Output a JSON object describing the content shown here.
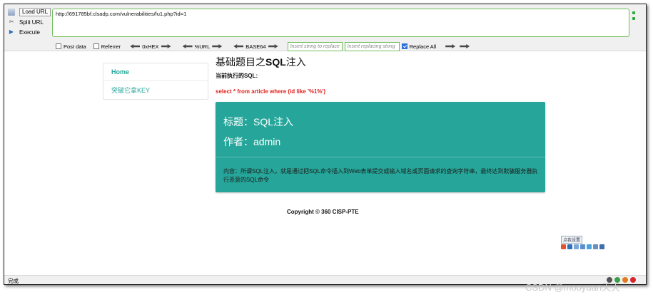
{
  "hackbar": {
    "actions": [
      {
        "label": "Load URL",
        "icon": "load-url-icon"
      },
      {
        "label": "Split URL",
        "icon": "split-url-icon"
      },
      {
        "label": "Execute",
        "icon": "execute-icon"
      }
    ],
    "url": "http://691785bf.clsadp.com/vulnerabilities/fu1.php?id=1",
    "options": {
      "post_data": "Post data",
      "referrer": "Referrer",
      "hex": "0xHEX",
      "url_enc": "%URL",
      "base64": "BASE64",
      "insert_string_placeholder": "Insert string to replace",
      "insert_replacing_placeholder": "Insert replacing string",
      "replace_all": "Replace All"
    }
  },
  "sidebar": {
    "items": [
      {
        "label": "Home",
        "active": true
      },
      {
        "label": "突破它拿KEY",
        "active": false
      }
    ]
  },
  "main": {
    "title_prefix": "基础题目之",
    "title_bold": "SQL",
    "title_suffix": "注入",
    "sql_label": "当前执行的SQL:",
    "sql_query": "select * from article where (id like '%1%')",
    "card": {
      "title_line": "标题：SQL注入",
      "author_line": "作者：admin",
      "content": "内容：所谓SQL注入，就是通过把SQL命令插入到Web表单提交或输入域名或页面请求的查询字符串，最终达到欺骗服务器执行恶意的SQL命令",
      "color": "#26a69a"
    },
    "copyright": "Copyright © 360 CISP-PTE"
  },
  "ime": {
    "settings_label": "点我设置"
  },
  "statusbar": {
    "text": "完成"
  },
  "watermark": "CSDN @mooyuan天天"
}
